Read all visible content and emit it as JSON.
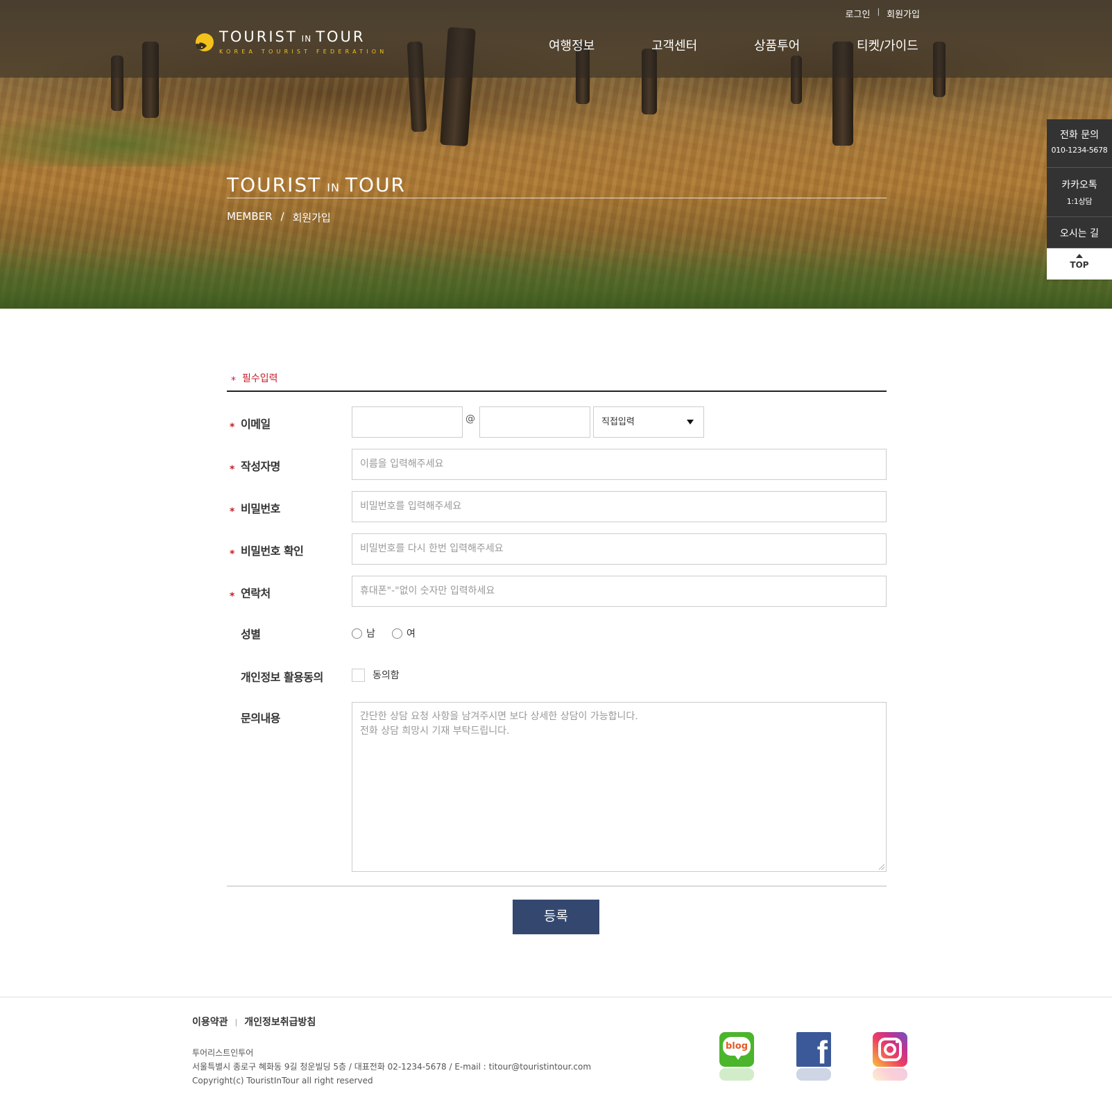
{
  "header": {
    "logo": {
      "title_left": "TOURIST",
      "title_mid": "IN",
      "title_right": "TOUR",
      "subtitle": "KOREA TOURIST FEDERATION",
      "icon": "sun-logo-icon"
    },
    "util": {
      "login": "로그인",
      "join": "회원가입",
      "separator": "|"
    },
    "nav": [
      "여행정보",
      "고객센터",
      "상품투어",
      "티켓/가이드"
    ]
  },
  "hero": {
    "title_left": "TOURIST",
    "title_mid": "IN",
    "title_right": "TOUR",
    "breadcrumb": {
      "section": "MEMBER",
      "separator": "/",
      "page": "회원가입"
    }
  },
  "quick_menu": {
    "phone": {
      "title": "전화 문의",
      "number": "010-1234-5678"
    },
    "kakao": {
      "title": "카카오톡",
      "sub": "1:1상담"
    },
    "map": {
      "title": "오시는 길"
    },
    "top": {
      "label": "TOP",
      "icon": "triangle-up-icon"
    }
  },
  "form": {
    "required_note": "필수입력",
    "required_mark": "*",
    "email": {
      "label": "이메일",
      "at": "@",
      "domain_select": "직접입력",
      "user_value": "",
      "domain_value": ""
    },
    "name": {
      "label": "작성자명",
      "placeholder": "이름을 입력해주세요"
    },
    "password": {
      "label": "비밀번호",
      "placeholder": "비밀번호를 입력해주세요"
    },
    "password_confirm": {
      "label": "비밀번호 확인",
      "placeholder": "비밀번호를 다시 한번 입력해주세요"
    },
    "phone": {
      "label": "연락처",
      "placeholder": "휴대폰\"-\"없이 숫자만 입력하세요"
    },
    "gender": {
      "label": "성별",
      "options": [
        "남",
        "여"
      ]
    },
    "consent": {
      "label": "개인정보 활용동의",
      "checkbox_label": "동의함"
    },
    "inquiry": {
      "label": "문의내용",
      "placeholder_line1": "간단한 상담 요청 사항을 남겨주시면 보다 상세한 상담이 가능합니다.",
      "placeholder_line2": "전화 상담 희망시 기재 부탁드립니다."
    },
    "submit": "등록"
  },
  "footer": {
    "links": [
      "이용약관",
      "개인정보취급방침"
    ],
    "separator": "|",
    "company": "투어리스트인투어",
    "address": "서울특별시 종로구 혜화동 9길 청운빌딩 5층 / 대표전화 02-1234-5678 / E-mail : titour@touristintour.com",
    "copyright": "Copyright(c) TouristInTour all right reserved",
    "sns": {
      "blog_label": "blog",
      "facebook_label": "f"
    }
  },
  "colors": {
    "accent_red": "#c41f2a",
    "button_navy": "#34486f",
    "logo_yellow": "#f3c21b",
    "quick_dark": "#333333"
  }
}
